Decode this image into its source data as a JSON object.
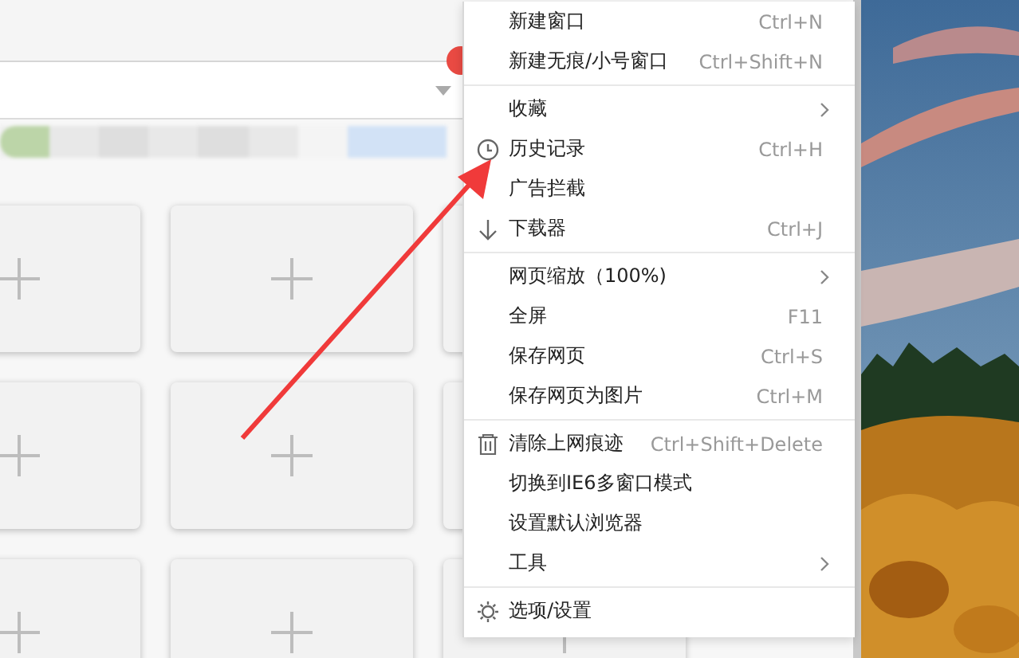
{
  "speed_dial": {
    "tiles": [
      {
        "kind": "empty"
      },
      {
        "kind": "empty"
      },
      {
        "kind": "covered"
      },
      {
        "kind": "empty"
      },
      {
        "kind": "empty"
      },
      {
        "kind": "covered"
      },
      {
        "kind": "empty"
      },
      {
        "kind": "empty"
      },
      {
        "kind": "empty"
      }
    ]
  },
  "menu": {
    "items": [
      {
        "kind": "item",
        "label": "新建窗口",
        "shortcut": "Ctrl+N"
      },
      {
        "kind": "item",
        "label": "新建无痕/小号窗口",
        "shortcut": "Ctrl+Shift+N"
      },
      {
        "kind": "separator"
      },
      {
        "kind": "item",
        "label": "收藏",
        "submenu": true
      },
      {
        "kind": "history",
        "label": "历史记录",
        "shortcut": "Ctrl+H"
      },
      {
        "kind": "item",
        "label": "广告拦截"
      },
      {
        "kind": "download",
        "label": "下载器",
        "shortcut": "Ctrl+J"
      },
      {
        "kind": "separator"
      },
      {
        "kind": "item",
        "label": "网页缩放（100%)",
        "submenu": true
      },
      {
        "kind": "item",
        "label": "全屏",
        "shortcut": "F11"
      },
      {
        "kind": "item",
        "label": "保存网页",
        "shortcut": "Ctrl+S"
      },
      {
        "kind": "item",
        "label": "保存网页为图片",
        "shortcut": "Ctrl+M"
      },
      {
        "kind": "separator"
      },
      {
        "kind": "clear",
        "label": "清除上网痕迹",
        "shortcut": "Ctrl+Shift+Delete"
      },
      {
        "kind": "item",
        "label": "切换到IE6多窗口模式"
      },
      {
        "kind": "item",
        "label": "设置默认浏览器"
      },
      {
        "kind": "item",
        "label": "工具",
        "submenu": true
      },
      {
        "kind": "separator"
      },
      {
        "kind": "settings",
        "label": "选项/设置"
      }
    ]
  }
}
